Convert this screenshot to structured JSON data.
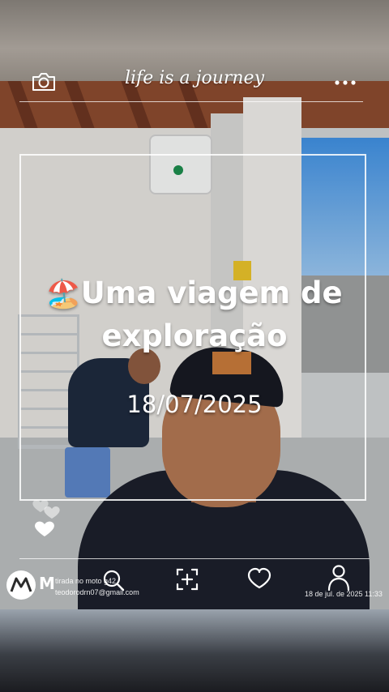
{
  "header": {
    "title": "life is a journey",
    "camera_icon": "camera-icon",
    "menu_icon": "more-dots-icon"
  },
  "overlay": {
    "headline_emoji": "🏖️",
    "headline_line1": "Uma viagem de",
    "headline_line2": "exploração",
    "date": "18/07/2025"
  },
  "footer": {
    "brand_mark": "M",
    "taken_with": "tirada no moto g42",
    "email": "teodorodrn07@gmail.com",
    "timestamp": "18 de jul. de 2025 11:33",
    "icons": [
      "search-icon",
      "add-photo-icon",
      "heart-icon",
      "person-icon"
    ]
  },
  "colors": {
    "overlay_text": "#ffffff",
    "cap_logo": "#c6793a"
  }
}
